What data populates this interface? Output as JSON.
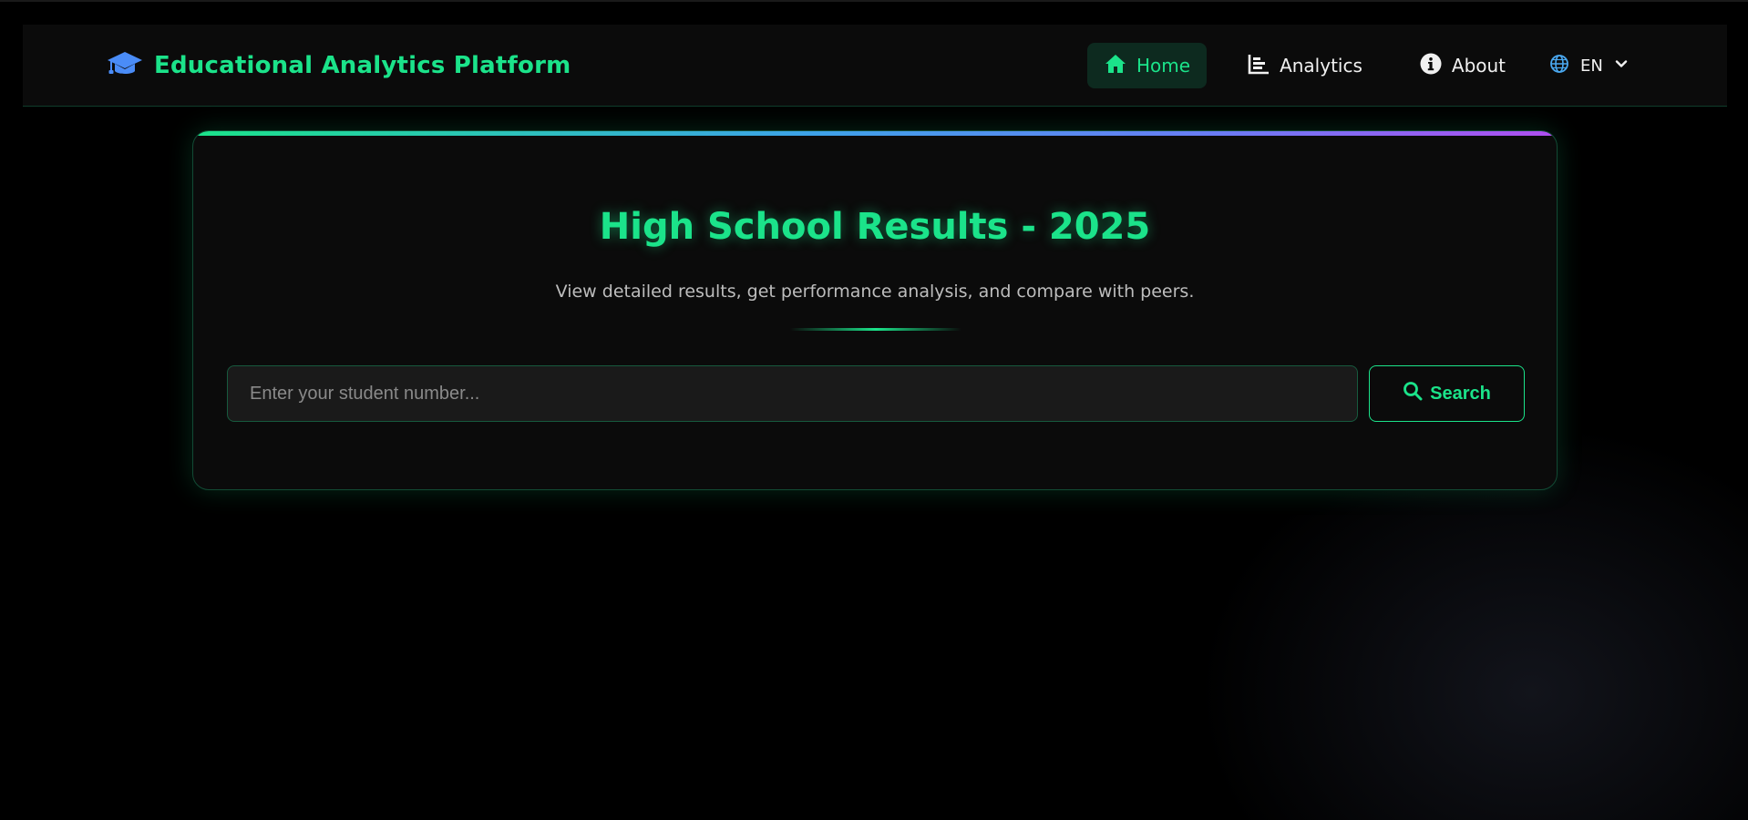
{
  "brand": {
    "title": "Educational Analytics Platform",
    "icon": "graduation-cap-icon",
    "icon_color": "#4a8cf7",
    "title_color": "#1be38a"
  },
  "nav": {
    "items": [
      {
        "label": "Home",
        "icon": "home-icon",
        "active": true
      },
      {
        "label": "Analytics",
        "icon": "bar-chart-icon",
        "active": false
      },
      {
        "label": "About",
        "icon": "info-icon",
        "active": false
      }
    ],
    "language": {
      "label": "EN",
      "icon": "globe-icon"
    }
  },
  "hero": {
    "title": "High School Results - 2025",
    "subtitle": "View detailed results, get performance analysis, and compare with peers."
  },
  "search": {
    "placeholder": "Enter your student number...",
    "value": "",
    "button_label": "Search"
  },
  "colors": {
    "accent": "#1be38a",
    "background": "#000000",
    "card": "#0b0b0b",
    "gradient": [
      "#1be38a",
      "#3da3e8",
      "#6a7cf5",
      "#b04ef0"
    ]
  }
}
